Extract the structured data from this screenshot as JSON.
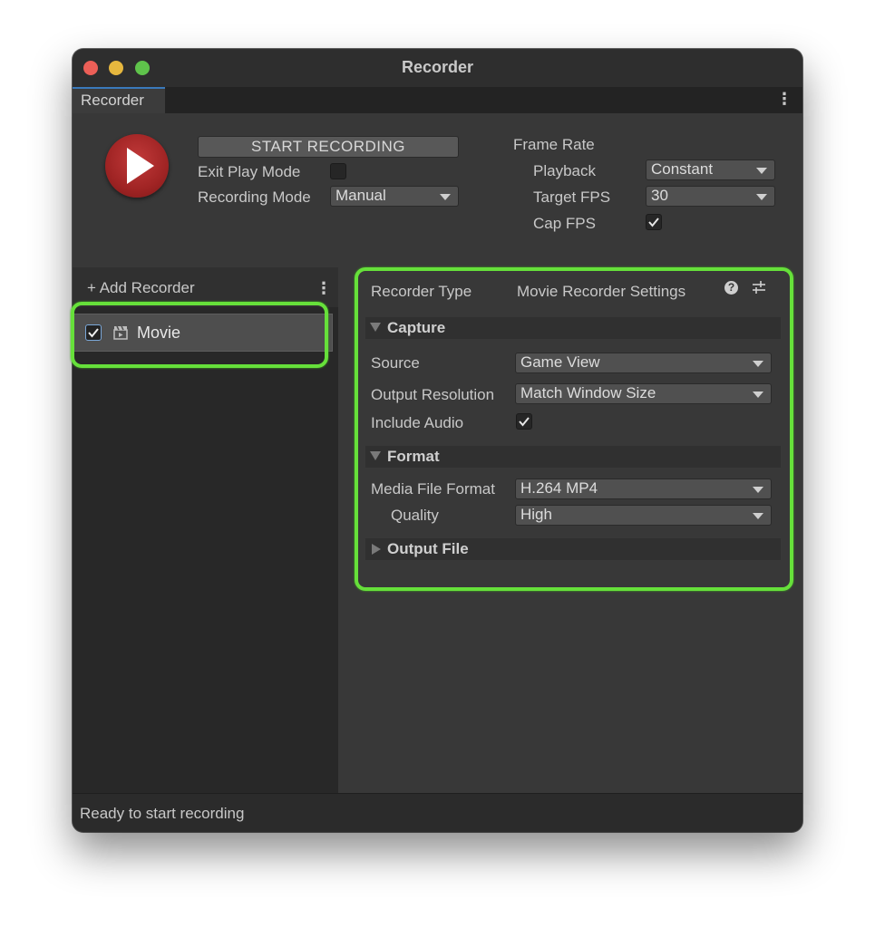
{
  "window": {
    "title": "Recorder",
    "tab_label": "Recorder",
    "colors": {
      "traffic_red": "#ec5f57",
      "traffic_yellow": "#e6b73e",
      "traffic_green": "#5fc34b",
      "highlight": "#66e03a",
      "record_button": "#a02424"
    }
  },
  "recording": {
    "start_label": "START RECORDING",
    "exit_play_mode_label": "Exit Play Mode",
    "exit_play_mode_checked": false,
    "recording_mode_label": "Recording Mode",
    "recording_mode_value": "Manual"
  },
  "frame_rate": {
    "title": "Frame Rate",
    "playback_label": "Playback",
    "playback_value": "Constant",
    "target_fps_label": "Target FPS",
    "target_fps_value": "30",
    "cap_fps_label": "Cap FPS",
    "cap_fps_checked": true
  },
  "recorder_list": {
    "add_label": "+ Add Recorder",
    "items": [
      {
        "label": "Movie",
        "enabled": true,
        "icon": "clapperboard-icon"
      }
    ]
  },
  "settings": {
    "recorder_type_label": "Recorder Type",
    "recorder_type_value": "Movie Recorder Settings",
    "capture": {
      "header": "Capture",
      "source_label": "Source",
      "source_value": "Game View",
      "output_resolution_label": "Output Resolution",
      "output_resolution_value": "Match Window Size",
      "include_audio_label": "Include Audio",
      "include_audio_checked": true
    },
    "format": {
      "header": "Format",
      "media_file_format_label": "Media File Format",
      "media_file_format_value": "H.264 MP4",
      "quality_label": "Quality",
      "quality_value": "High"
    },
    "output_file": {
      "header": "Output File"
    }
  },
  "status": {
    "text": "Ready to start recording"
  }
}
